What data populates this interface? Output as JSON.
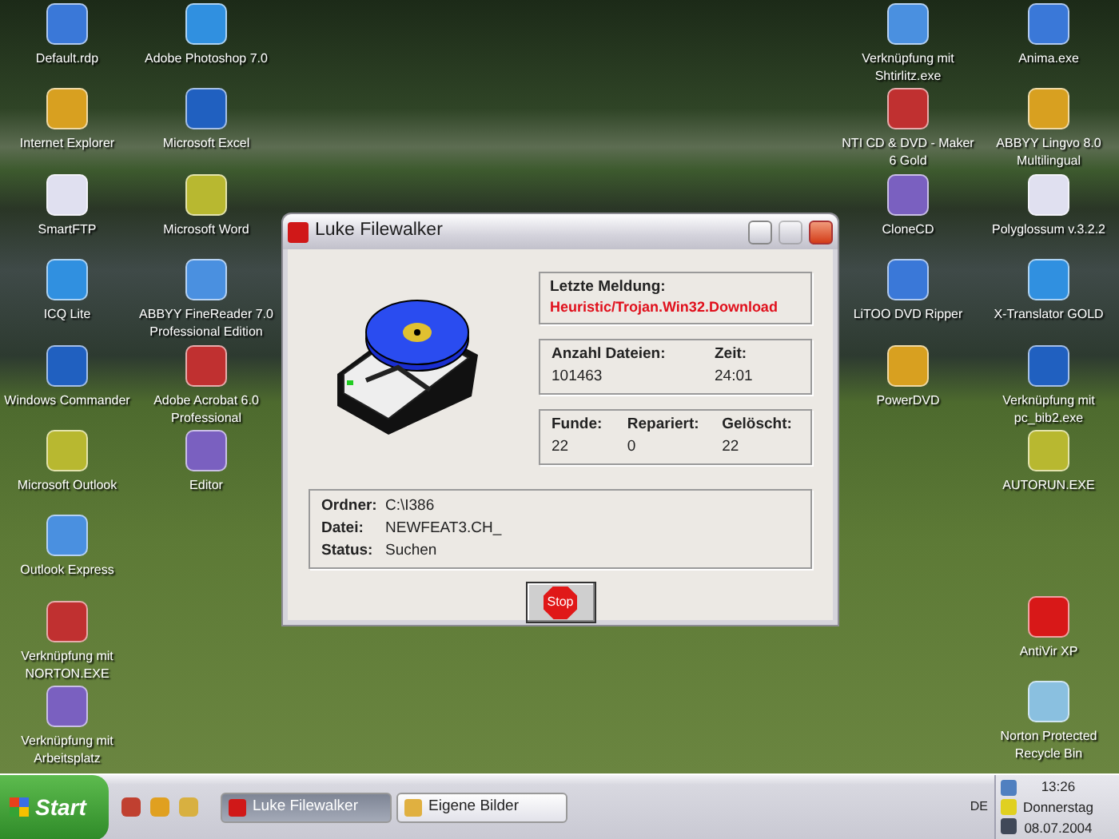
{
  "desktop": {
    "columns": [
      [
        {
          "label": "Default.rdp"
        },
        {
          "label": "Internet Explorer"
        },
        {
          "label": "SmartFTP"
        },
        {
          "label": "ICQ Lite"
        },
        {
          "label": "Windows Commander"
        },
        {
          "label": "Microsoft Outlook"
        },
        {
          "label": "Outlook Express"
        },
        {
          "label": "Verknüpfung mit NORTON.EXE"
        },
        {
          "label": "Verknüpfung mit Arbeitsplatz"
        }
      ],
      [
        {
          "label": "Adobe Photoshop 7.0"
        },
        {
          "label": "Microsoft Excel"
        },
        {
          "label": "Microsoft Word"
        },
        {
          "label": "ABBYY FineReader 7.0 Professional Edition"
        },
        {
          "label": "Adobe Acrobat 6.0 Professional"
        },
        {
          "label": "Editor"
        }
      ],
      [
        {
          "label": "Verknüpfung mit Shtirlitz.exe"
        },
        {
          "label": "NTI CD & DVD - Maker 6 Gold"
        },
        {
          "label": "CloneCD"
        },
        {
          "label": "LiTOO DVD Ripper"
        },
        {
          "label": "PowerDVD"
        }
      ],
      [
        {
          "label": "Anima.exe"
        },
        {
          "label": "ABBYY Lingvo 8.0 Multilingual"
        },
        {
          "label": "Polyglossum v.3.2.2"
        },
        {
          "label": "X-Translator GOLD"
        },
        {
          "label": "Verknüpfung mit pc_bib2.exe"
        },
        {
          "label": "AUTORUN.EXE"
        }
      ]
    ],
    "bottom_right": [
      {
        "label": "AntiVir XP"
      },
      {
        "label": "Norton Protected Recycle Bin"
      }
    ]
  },
  "window": {
    "title": "Luke Filewalker",
    "last_message": {
      "label": "Letzte Meldung:",
      "value": "Heuristic/Trojan.Win32.Download"
    },
    "counts": [
      {
        "label": "Anzahl Dateien:",
        "value": "101463"
      },
      {
        "label": "Zeit:",
        "value": "24:01"
      }
    ],
    "results": [
      {
        "label": "Funde:",
        "value": "22"
      },
      {
        "label": "Repariert:",
        "value": "0"
      },
      {
        "label": "Gelöscht:",
        "value": "22"
      }
    ],
    "details": [
      {
        "label": "Ordner:",
        "value": "C:\\I386"
      },
      {
        "label": "Datei:",
        "value": "NEWFEAT3.CH_"
      },
      {
        "label": "Status:",
        "value": "Suchen"
      }
    ],
    "stop_button": "Stop"
  },
  "taskbar": {
    "start": "Start",
    "tasks": [
      {
        "label": "Luke Filewalker",
        "selected": true
      },
      {
        "label": "Eigene Bilder",
        "selected": false
      }
    ],
    "language": "DE",
    "clock": {
      "time": "13:26",
      "day": "Donnerstag",
      "date": "08.07.2004"
    }
  }
}
